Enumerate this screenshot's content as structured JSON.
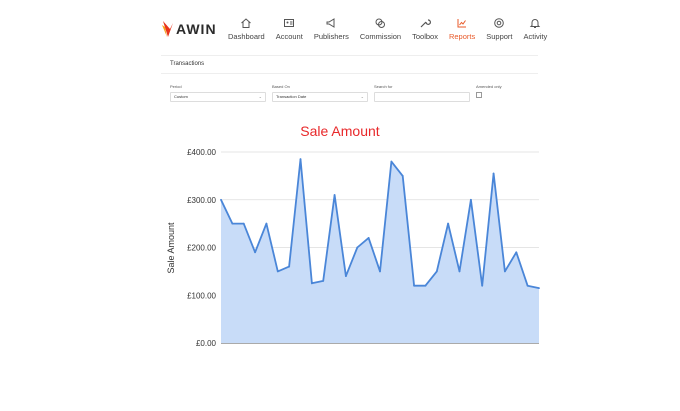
{
  "brand": {
    "logo_text": "AWIN",
    "accent": "#e85a2a"
  },
  "nav": [
    {
      "label": "Dashboard",
      "icon": "home-icon"
    },
    {
      "label": "Account",
      "icon": "id-card-icon"
    },
    {
      "label": "Publishers",
      "icon": "megaphone-icon"
    },
    {
      "label": "Commission",
      "icon": "coins-icon"
    },
    {
      "label": "Toolbox",
      "icon": "wrench-icon"
    },
    {
      "label": "Reports",
      "icon": "bar-chart-icon",
      "active": true
    },
    {
      "label": "Support",
      "icon": "lifebuoy-icon"
    },
    {
      "label": "Activity",
      "icon": "bell-icon"
    }
  ],
  "page": {
    "section_title": "Transactions"
  },
  "filters": {
    "period": {
      "label": "Period",
      "value": "Custom"
    },
    "based_on": {
      "label": "Based On",
      "value": "Transaction Date"
    },
    "search_for": {
      "label": "Search for",
      "value": ""
    },
    "amended_only": {
      "label": "Amended only",
      "checked": false
    }
  },
  "chart_data": {
    "type": "area",
    "title": "Sale Amount",
    "xlabel": "",
    "ylabel": "Sale Amount",
    "ylim": [
      0,
      400
    ],
    "y_ticks": [
      "£0.00",
      "£100.00",
      "£200.00",
      "£300.00",
      "£400.00"
    ],
    "grid": true,
    "color": "#4a86d8",
    "fill": "#c8dcf8",
    "values": [
      300,
      250,
      250,
      190,
      250,
      150,
      160,
      385,
      125,
      130,
      310,
      140,
      200,
      220,
      150,
      380,
      350,
      120,
      120,
      150,
      250,
      150,
      300,
      120,
      355,
      150,
      190,
      120,
      115
    ]
  }
}
